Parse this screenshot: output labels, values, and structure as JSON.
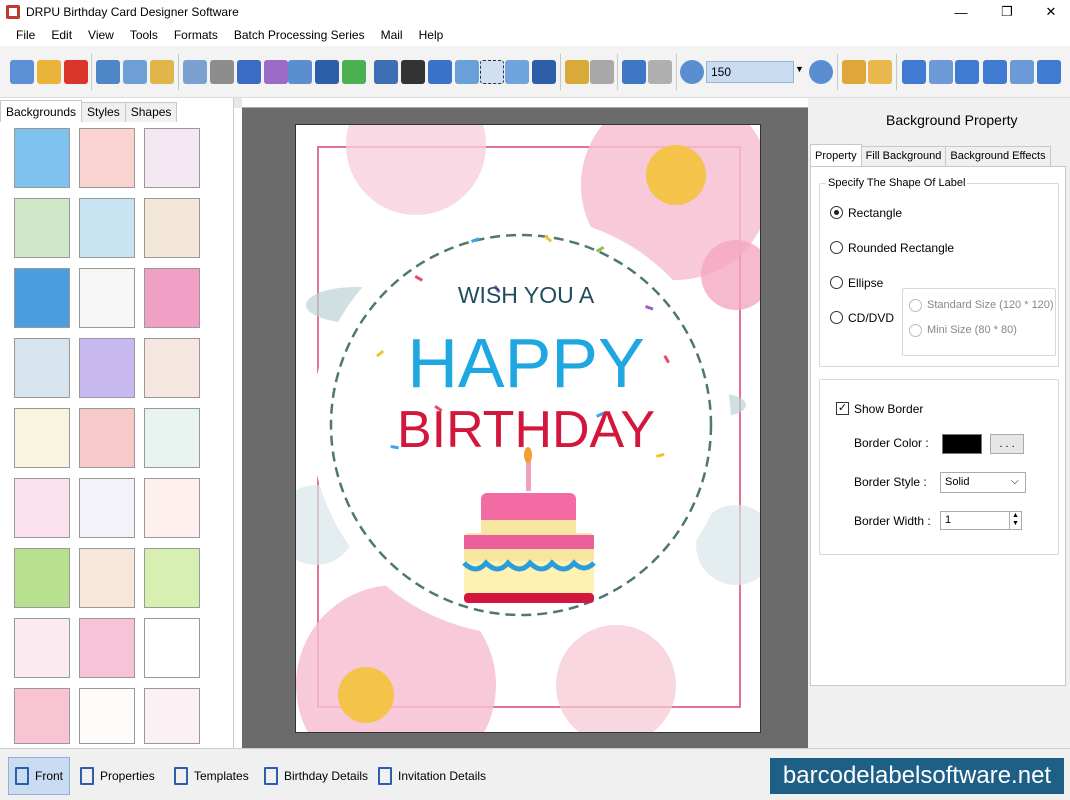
{
  "window": {
    "title": "DRPU Birthday Card Designer Software",
    "minimize": "—",
    "maximize": "❐",
    "close": "✕"
  },
  "menu": [
    "File",
    "Edit",
    "View",
    "Tools",
    "Formats",
    "Batch Processing Series",
    "Mail",
    "Help"
  ],
  "toolbar": {
    "zoom_value": "150"
  },
  "left_panel": {
    "tabs": [
      "Backgrounds",
      "Styles",
      "Shapes"
    ],
    "active_tab": "Backgrounds"
  },
  "card": {
    "line1": "WISH YOU A",
    "line2": "HAPPY",
    "line3": "BIRTHDAY",
    "colors": {
      "line1": "#1f4e5f",
      "line2": "#1ea7e0",
      "line3": "#d3173c"
    }
  },
  "right_panel": {
    "title": "Background Property",
    "tabs": [
      "Property",
      "Fill Background",
      "Background Effects"
    ],
    "shape_group_label": "Specify The Shape Of Label",
    "shapes": {
      "rectangle": "Rectangle",
      "rounded": "Rounded Rectangle",
      "ellipse": "Ellipse",
      "cd": "CD/DVD",
      "standard": "Standard Size (120 * 120)",
      "mini": "Mini Size (80 * 80)"
    },
    "selected_shape": "Rectangle",
    "show_border_label": "Show Border",
    "show_border_checked": true,
    "border_color_label": "Border Color :",
    "border_color": "#000000",
    "border_color_button": ". . .",
    "border_style_label": "Border Style :",
    "border_style_value": "Solid",
    "border_width_label": "Border Width :",
    "border_width_value": "1"
  },
  "bottom_tabs": [
    "Front",
    "Properties",
    "Templates",
    "Birthday Details",
    "Invitation Details"
  ],
  "brand": "barcodelabelsoftware.net"
}
